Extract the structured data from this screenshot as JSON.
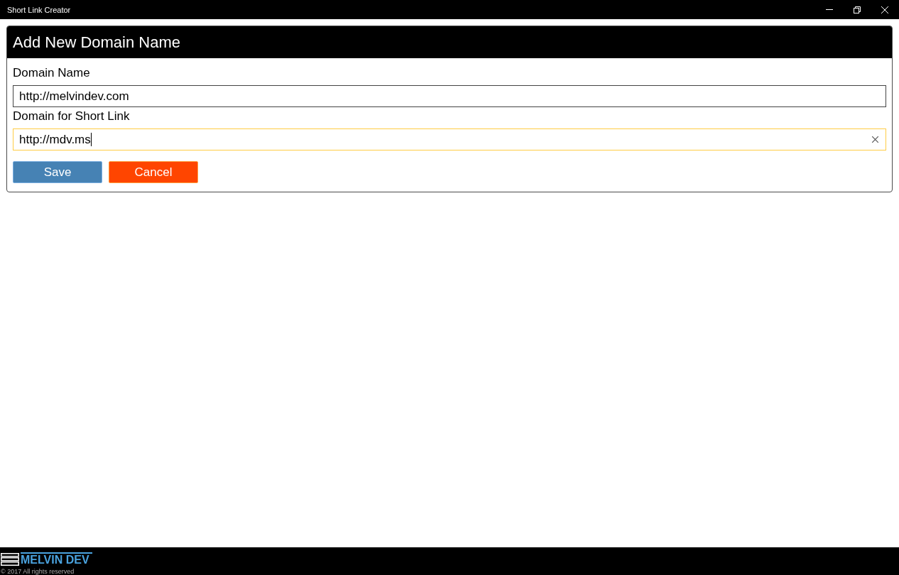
{
  "window": {
    "title": "Short Link Creator"
  },
  "dialog": {
    "title": "Add New Domain Name",
    "fields": [
      {
        "label": "Domain Name",
        "value": "http://melvindev.com",
        "focused": false
      },
      {
        "label": "Domain for Short Link",
        "value": "http://mdv.ms",
        "focused": true
      }
    ],
    "buttons": [
      {
        "label": "Save",
        "kind": "primary"
      },
      {
        "label": "Cancel",
        "kind": "danger"
      }
    ]
  },
  "footer": {
    "brand": "MELVIN DEV",
    "copyright": "© 2017 All rights reserved"
  }
}
